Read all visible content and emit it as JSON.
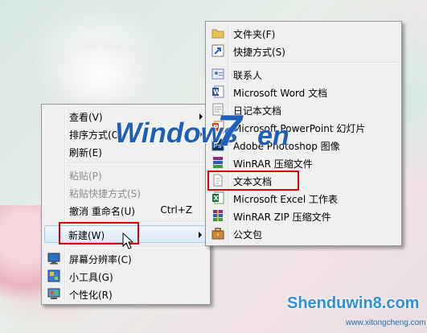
{
  "context_menu": {
    "items": [
      {
        "label": "查看(V)",
        "arrow": true
      },
      {
        "label": "排序方式(O)",
        "arrow": true
      },
      {
        "label": "刷新(E)"
      },
      {
        "label": "粘贴(P)",
        "disabled": true
      },
      {
        "label": "粘贴快捷方式(S)",
        "disabled": true
      },
      {
        "label": "撤消 重命名(U)",
        "shortcut": "Ctrl+Z"
      },
      {
        "label": "新建(W)",
        "arrow": true
      },
      {
        "label": "屏幕分辨率(C)",
        "icon": "display-icon"
      },
      {
        "label": "小工具(G)",
        "icon": "gadgets-icon"
      },
      {
        "label": "个性化(R)",
        "icon": "personalize-icon"
      }
    ]
  },
  "new_submenu": {
    "items": [
      {
        "label": "文件夹(F)",
        "icon": "folder-icon"
      },
      {
        "label": "快捷方式(S)",
        "icon": "shortcut-icon"
      },
      {
        "label": "联系人",
        "icon": "contact-icon"
      },
      {
        "label": "Microsoft Word 文档",
        "icon": "word-icon"
      },
      {
        "label": "日记本文档",
        "icon": "journal-icon"
      },
      {
        "label": "Microsoft PowerPoint 幻灯片",
        "icon": "powerpoint-icon"
      },
      {
        "label": "Adobe Photoshop 图像",
        "icon": "photoshop-icon"
      },
      {
        "label": "WinRAR 压缩文件",
        "icon": "winrar-icon"
      },
      {
        "label": "文本文档",
        "icon": "text-document-icon"
      },
      {
        "label": "Microsoft Excel 工作表",
        "icon": "excel-icon"
      },
      {
        "label": "WinRAR ZIP 压缩文件",
        "icon": "winrar-zip-icon"
      },
      {
        "label": "公文包",
        "icon": "briefcase-icon"
      }
    ]
  },
  "watermark": {
    "logo_main": "Windows",
    "logo_seven": "7",
    "logo_tail": "en",
    "site": "Shenduwin8.com",
    "site_small": "www.xitongcheng.com"
  },
  "colors": {
    "highlight_border": "#a8c8ec",
    "annotation_red": "#e10000",
    "logo_blue": "#1f5fb8"
  }
}
